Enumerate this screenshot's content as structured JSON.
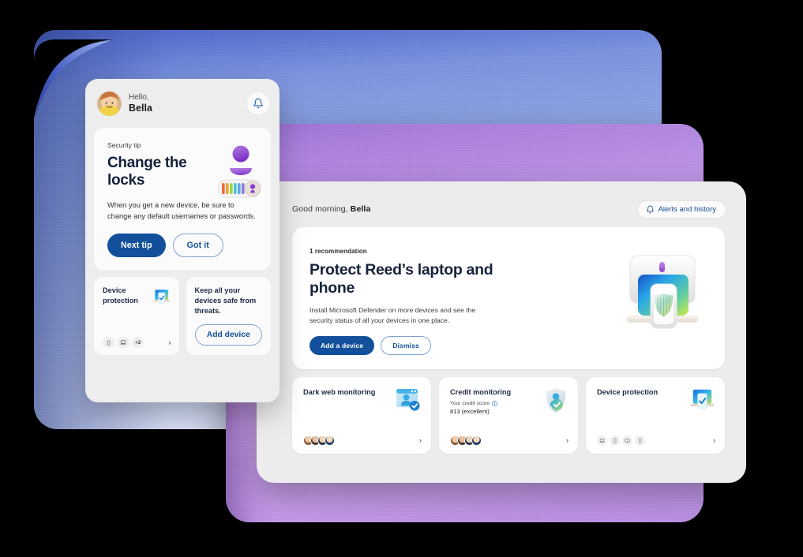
{
  "theme": {
    "background": "#000000",
    "blue_card": "#8fa5e8",
    "purple_card": "#c79ceb",
    "accent_blue": "#12509b",
    "window_bg": "#ececec",
    "card_bg": "#ffffff"
  },
  "mobile": {
    "header": {
      "greeting_small": "Hello,",
      "user_name": "Bella",
      "avatar_name": "user-avatar",
      "bell_icon": "bell-icon"
    },
    "tip_card": {
      "eyebrow": "Security tip",
      "title": "Change the locks",
      "body": "When you get a new device, be sure to change any default usernames or passwords.",
      "primary_button": "Next tip",
      "secondary_button": "Got it",
      "illustration": "identity-lock-illustration"
    },
    "tiles": [
      {
        "title": "Device protection",
        "illustration": "device-protection-illustration",
        "chips": [
          "phone",
          "laptop",
          "+2"
        ],
        "chip_more_label": "+2",
        "chevron": "›"
      },
      {
        "text": "Keep all your devices safe from threats.",
        "button": "Add device"
      }
    ]
  },
  "desktop": {
    "topbar": {
      "greeting_prefix": "Good morning, ",
      "user_name": "Bella",
      "alerts_button": "Alerts and history",
      "alerts_icon": "bell-icon"
    },
    "hero": {
      "eyebrow": "1 recommendation",
      "title": "Protect Reed’s laptop and phone",
      "subtitle": "Install Microsoft Defender on more devices and see the security status of all your devices in one place.",
      "primary_button": "Add a device",
      "secondary_button": "Dismiss",
      "illustration": "devices-shield-illustration"
    },
    "features": [
      {
        "title": "Dark web monitoring",
        "icon": "dark-web-monitoring-icon",
        "avatars": 4,
        "chevron": "›"
      },
      {
        "title": "Credit monitoring",
        "icon": "credit-monitoring-shield-icon",
        "score_label": "Your credit score",
        "info_icon": "info-icon",
        "score_value": "813 (excellent)",
        "avatars": 4,
        "chevron": "›"
      },
      {
        "title": "Device protection",
        "icon": "device-protection-icon",
        "devices": [
          "laptop",
          "phone",
          "desktop",
          "phone"
        ],
        "chevron": "›"
      }
    ]
  }
}
